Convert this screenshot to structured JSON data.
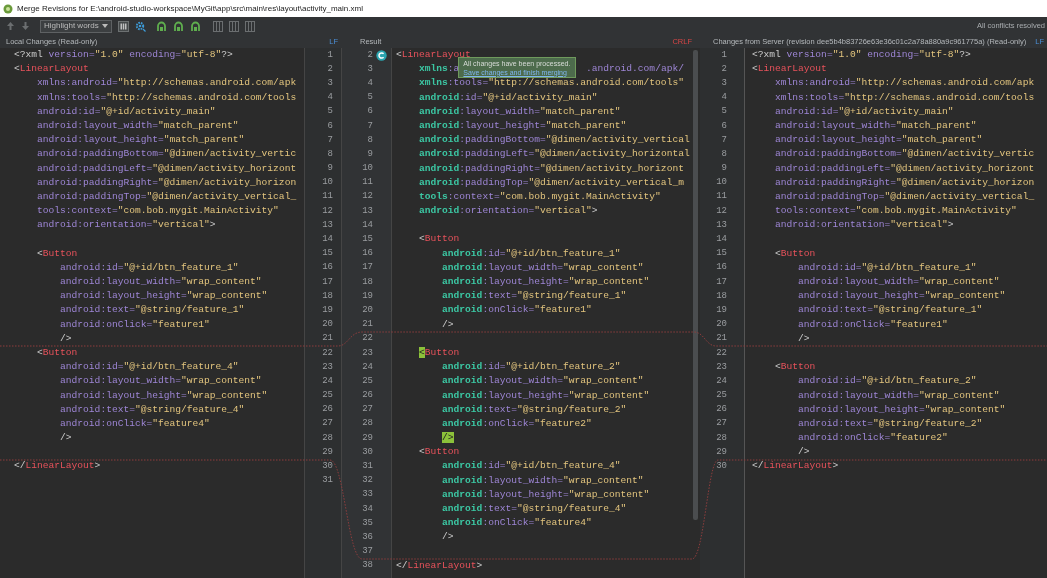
{
  "window": {
    "title": "Merge Revisions for E:\\android-studio-workspace\\MyGit\\app\\src\\main\\res\\layout\\activity_main.xml"
  },
  "toolbar": {
    "highlight_dropdown": "Highlight words",
    "status": "All conflicts resolved"
  },
  "panels": [
    {
      "kind": "local",
      "header": "Local Changes (Read-only)",
      "line_separator": "LF",
      "separator_warning": false,
      "editable": false,
      "lines": [
        {
          "number": "1",
          "text": "<?xml version=\"1.0\" encoding=\"utf-8\"?>"
        },
        {
          "number": "2",
          "text": "<LinearLayout"
        },
        {
          "number": "3",
          "text": "    xmlns:android=\"http://schemas.android.com/apk"
        },
        {
          "number": "4",
          "text": "    xmlns:tools=\"http://schemas.android.com/tools"
        },
        {
          "number": "5",
          "text": "    android:id=\"@+id/activity_main\""
        },
        {
          "number": "6",
          "text": "    android:layout_width=\"match_parent\""
        },
        {
          "number": "7",
          "text": "    android:layout_height=\"match_parent\""
        },
        {
          "number": "8",
          "text": "    android:paddingBottom=\"@dimen/activity_vertic"
        },
        {
          "number": "9",
          "text": "    android:paddingLeft=\"@dimen/activity_horizont"
        },
        {
          "number": "10",
          "text": "    android:paddingRight=\"@dimen/activity_horizon"
        },
        {
          "number": "11",
          "text": "    android:paddingTop=\"@dimen/activity_vertical_"
        },
        {
          "number": "12",
          "text": "    tools:context=\"com.bob.mygit.MainActivity\""
        },
        {
          "number": "13",
          "text": "    android:orientation=\"vertical\">"
        },
        {
          "number": "14"
        },
        {
          "number": "15",
          "text": "    <Button"
        },
        {
          "number": "16",
          "text": "        android:id=\"@+id/btn_feature_1\""
        },
        {
          "number": "17",
          "text": "        android:layout_width=\"wrap_content\""
        },
        {
          "number": "18",
          "text": "        android:layout_height=\"wrap_content\""
        },
        {
          "number": "19",
          "text": "        android:text=\"@string/feature_1\""
        },
        {
          "number": "20",
          "text": "        android:onClick=\"feature1\""
        },
        {
          "number": "21",
          "text": "        />"
        },
        {
          "number": "22",
          "text": "    <Button"
        },
        {
          "number": "23",
          "text": "        android:id=\"@+id/btn_feature_4\""
        },
        {
          "number": "24",
          "text": "        android:layout_width=\"wrap_content\""
        },
        {
          "number": "25",
          "text": "        android:layout_height=\"wrap_content\""
        },
        {
          "number": "26",
          "text": "        android:text=\"@string/feature_4\""
        },
        {
          "number": "27",
          "text": "        android:onClick=\"feature4\""
        },
        {
          "number": "28",
          "text": "        />"
        },
        {
          "number": "29"
        },
        {
          "number": "30",
          "text": "</LinearLayout>"
        },
        {
          "number": "31"
        }
      ]
    },
    {
      "kind": "result",
      "header": "Result",
      "line_separator": "CRLF",
      "separator_warning": true,
      "editable": true,
      "popup": {
        "message": "All changes have been processed.",
        "link": "Save changes and finish merging"
      },
      "lines": [
        {
          "number": "2",
          "text": "<LinearLayout",
          "marker": true
        },
        {
          "number": "3",
          "text": "    xmlns:a",
          "text_after_popup": ".android.com/apk/"
        },
        {
          "number": "4",
          "text": "    xmlns:tools=\"http://schemas.android.com/tools\""
        },
        {
          "number": "5",
          "text": "    android:id=\"@+id/activity_main\""
        },
        {
          "number": "6",
          "text": "    android:layout_width=\"match_parent\""
        },
        {
          "number": "7",
          "text": "    android:layout_height=\"match_parent\""
        },
        {
          "number": "8",
          "text": "    android:paddingBottom=\"@dimen/activity_vertical"
        },
        {
          "number": "9",
          "text": "    android:paddingLeft=\"@dimen/activity_horizontal"
        },
        {
          "number": "10",
          "text": "    android:paddingRight=\"@dimen/activity_horizont"
        },
        {
          "number": "11",
          "text": "    android:paddingTop=\"@dimen/activity_vertical_m"
        },
        {
          "number": "12",
          "text": "    tools:context=\"com.bob.mygit.MainActivity\""
        },
        {
          "number": "13",
          "text": "    android:orientation=\"vertical\">"
        },
        {
          "number": "14"
        },
        {
          "number": "15",
          "text": "    <Button"
        },
        {
          "number": "16",
          "text": "        android:id=\"@+id/btn_feature_1\""
        },
        {
          "number": "17",
          "text": "        android:layout_width=\"wrap_content\""
        },
        {
          "number": "18",
          "text": "        android:layout_height=\"wrap_content\""
        },
        {
          "number": "19",
          "text": "        android:text=\"@string/feature_1\""
        },
        {
          "number": "20",
          "text": "        android:onClick=\"feature1\""
        },
        {
          "number": "21",
          "text": "        />"
        },
        {
          "number": "22"
        },
        {
          "number": "23",
          "text": "    <Button",
          "brace_match": true
        },
        {
          "number": "24",
          "text": "        android:id=\"@+id/btn_feature_2\""
        },
        {
          "number": "25",
          "text": "        android:layout_width=\"wrap_content\""
        },
        {
          "number": "26",
          "text": "        android:layout_height=\"wrap_content\""
        },
        {
          "number": "27",
          "text": "        android:text=\"@string/feature_2\""
        },
        {
          "number": "28",
          "text": "        android:onClick=\"feature2\""
        },
        {
          "number": "29",
          "text": "        />",
          "brace_match": true
        },
        {
          "number": "30",
          "text": "    <Button"
        },
        {
          "number": "31",
          "text": "        android:id=\"@+id/btn_feature_4\""
        },
        {
          "number": "32",
          "text": "        android:layout_width=\"wrap_content\""
        },
        {
          "number": "33",
          "text": "        android:layout_height=\"wrap_content\""
        },
        {
          "number": "34",
          "text": "        android:text=\"@string/feature_4\""
        },
        {
          "number": "35",
          "text": "        android:onClick=\"feature4\""
        },
        {
          "number": "36",
          "text": "        />"
        },
        {
          "number": "37"
        },
        {
          "number": "38",
          "text": "</LinearLayout>"
        }
      ]
    },
    {
      "kind": "server",
      "header": "Changes from Server (revision dee5b4b83726e63e36c01c2a78a880a9c961775a) (Read-only)",
      "line_separator": "LF",
      "separator_warning": false,
      "editable": false,
      "lines": [
        {
          "number": "1",
          "text": "<?xml version=\"1.0\" encoding=\"utf-8\"?>"
        },
        {
          "number": "2",
          "text": "<LinearLayout"
        },
        {
          "number": "3",
          "text": "    xmlns:android=\"http://schemas.android.com/apk"
        },
        {
          "number": "4",
          "text": "    xmlns:tools=\"http://schemas.android.com/tools"
        },
        {
          "number": "5",
          "text": "    android:id=\"@+id/activity_main\""
        },
        {
          "number": "6",
          "text": "    android:layout_width=\"match_parent\""
        },
        {
          "number": "7",
          "text": "    android:layout_height=\"match_parent\""
        },
        {
          "number": "8",
          "text": "    android:paddingBottom=\"@dimen/activity_vertic"
        },
        {
          "number": "9",
          "text": "    android:paddingLeft=\"@dimen/activity_horizont"
        },
        {
          "number": "10",
          "text": "    android:paddingRight=\"@dimen/activity_horizon"
        },
        {
          "number": "11",
          "text": "    android:paddingTop=\"@dimen/activity_vertical_"
        },
        {
          "number": "12",
          "text": "    tools:context=\"com.bob.mygit.MainActivity\""
        },
        {
          "number": "13",
          "text": "    android:orientation=\"vertical\">"
        },
        {
          "number": "14"
        },
        {
          "number": "15",
          "text": "    <Button"
        },
        {
          "number": "16",
          "text": "        android:id=\"@+id/btn_feature_1\""
        },
        {
          "number": "17",
          "text": "        android:layout_width=\"wrap_content\""
        },
        {
          "number": "18",
          "text": "        android:layout_height=\"wrap_content\""
        },
        {
          "number": "19",
          "text": "        android:text=\"@string/feature_1\""
        },
        {
          "number": "20",
          "text": "        android:onClick=\"feature1\""
        },
        {
          "number": "21",
          "text": "        />"
        },
        {
          "number": "22"
        },
        {
          "number": "23",
          "text": "    <Button"
        },
        {
          "number": "24",
          "text": "        android:id=\"@+id/btn_feature_2\""
        },
        {
          "number": "25",
          "text": "        android:layout_width=\"wrap_content\""
        },
        {
          "number": "26",
          "text": "        android:layout_height=\"wrap_content\""
        },
        {
          "number": "27",
          "text": "        android:text=\"@string/feature_2\""
        },
        {
          "number": "28",
          "text": "        android:onClick=\"feature2\""
        },
        {
          "number": "29",
          "text": "        />"
        },
        {
          "number": "30",
          "text": "</LinearLayout>"
        }
      ]
    }
  ]
}
